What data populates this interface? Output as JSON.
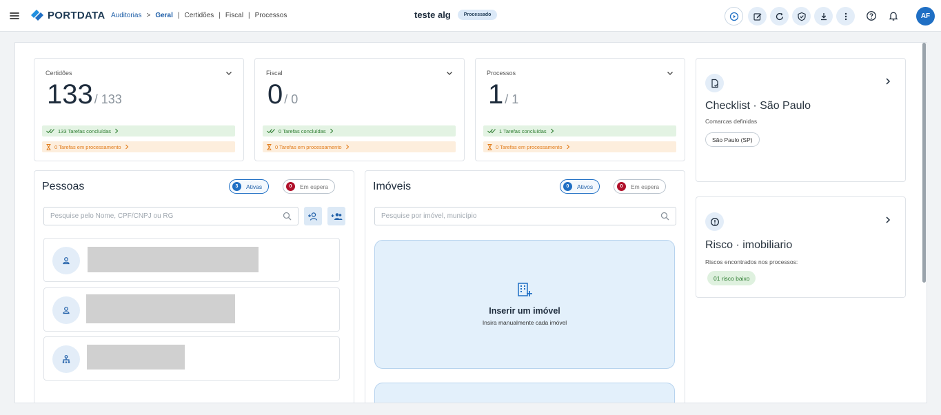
{
  "header": {
    "app_name": "PORTDATA",
    "breadcrumb": {
      "root": "Auditorias",
      "arrow": ">",
      "active": "Geral",
      "items": [
        "Certidões",
        "Fiscal",
        "Processos"
      ],
      "separator": "|"
    },
    "document_title": "teste alg",
    "status": "Processado",
    "toolbar_icons": [
      "play-circle-icon",
      "edit-icon",
      "refresh-icon",
      "shield-check-icon",
      "download-icon",
      "more-vertical-icon",
      "help-icon",
      "bell-icon"
    ],
    "user_initials": "AF"
  },
  "colors": {
    "primary": "#1f6fc4",
    "success": "#2e7d32",
    "warning": "#e07b1a",
    "danger": "#b0102a",
    "accent_light": "#e3edf8"
  },
  "stats": [
    {
      "label": "Certidões",
      "value": "133",
      "total": "/ 133",
      "done": "133 Tarefas concluídas",
      "processing": "0 Tarefas em processamento"
    },
    {
      "label": "Fiscal",
      "value": "0",
      "total": "/ 0",
      "done": "0 Tarefas concluídas",
      "processing": "0 Tarefas em processamento"
    },
    {
      "label": "Processos",
      "value": "1",
      "total": "/ 1",
      "done": "1 Tarefas concluídas",
      "processing": "0 Tarefas em processamento"
    }
  ],
  "pessoas": {
    "title": "Pessoas",
    "active_count": "3",
    "active_label": "Ativas",
    "waiting_count": "0",
    "waiting_label": "Em espera",
    "search_placeholder": "Pesquise pelo Nome, CPF/CNPJ ou RG",
    "people": [
      {
        "type": "person-icon"
      },
      {
        "type": "person-icon"
      },
      {
        "type": "company-icon"
      }
    ]
  },
  "imoveis": {
    "title": "Imóveis",
    "active_count": "0",
    "active_label": "Ativos",
    "waiting_count": "0",
    "waiting_label": "Em espera",
    "search_placeholder": "Pesquise por imóvel, município",
    "insert_title": "Inserir um imóvel",
    "insert_subtitle": "Insira manualmente cada imóvel"
  },
  "checklist": {
    "title": "Checklist · São Paulo",
    "subtitle": "Comarcas definidas",
    "tag": "São Paulo (SP)"
  },
  "risco": {
    "title": "Risco · imobiliario",
    "subtitle": "Riscos encontrados nos processos:",
    "tag": "01 risco baixo"
  }
}
